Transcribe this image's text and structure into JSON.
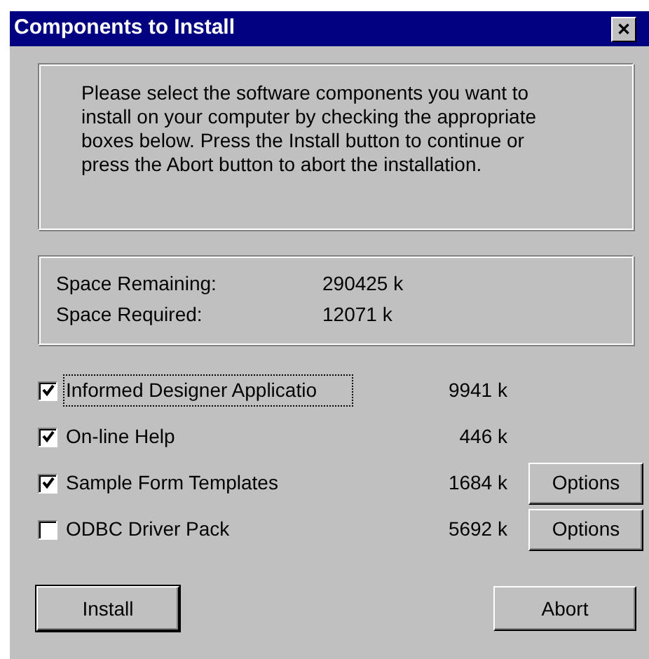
{
  "window": {
    "title": "Components to Install",
    "close": "✕"
  },
  "description": "Please select the software components you want to install on your computer by checking the appropriate boxes below. Press the Install button to continue or press the Abort button to abort the installation.",
  "space": [
    {
      "label": "Space Remaining:",
      "value": "290425 k"
    },
    {
      "label": "Space Required:",
      "value": "12071 k"
    }
  ],
  "components": [
    {
      "label": "Informed Designer Applicatio",
      "size": "9941 k",
      "checked": true,
      "focused": true
    },
    {
      "label": "On-line Help",
      "size": "446 k",
      "checked": true,
      "focused": false
    },
    {
      "label": "Sample Form Templates",
      "size": "1684 k",
      "checked": true,
      "focused": false,
      "options": "Options"
    },
    {
      "label": "ODBC Driver Pack",
      "size": "5692 k",
      "checked": false,
      "focused": false,
      "options": "Options"
    }
  ],
  "buttons": [
    {
      "label": "Install",
      "default": true
    },
    {
      "label": "Abort",
      "default": false
    }
  ]
}
